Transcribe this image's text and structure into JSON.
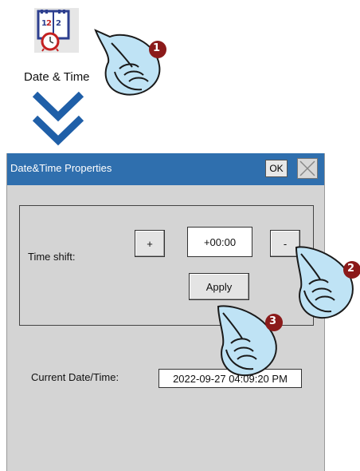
{
  "desktop": {
    "icon_label": "Date & Time",
    "icon": "calendar-clock-icon"
  },
  "steps": [
    "1",
    "2",
    "3"
  ],
  "dialog": {
    "title": "Date&Time Properties",
    "ok_label": "OK",
    "close_icon": "close-icon",
    "time_shift_label": "Time shift:",
    "plus_label": "+",
    "minus_label": "-",
    "time_shift_value": "+00:00",
    "apply_label": "Apply",
    "current_label": "Current Date/Time:",
    "current_value": "2022-09-27 04:09:20 PM"
  },
  "colors": {
    "titlebar": "#2f6fae",
    "step_badge": "#8b1a1a",
    "hand_bubble": "#bfe3f5",
    "arrow": "#1f5fa8"
  }
}
